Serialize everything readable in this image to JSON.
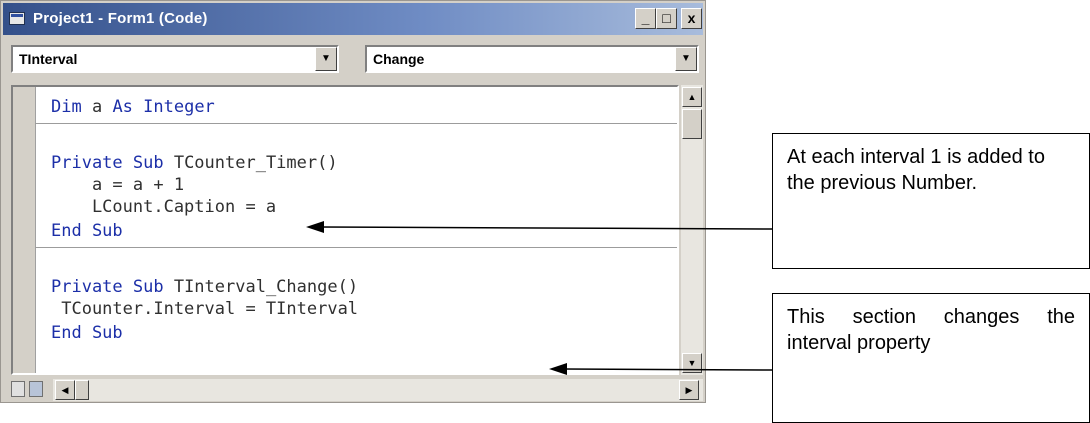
{
  "window": {
    "title": "Project1 - Form1 (Code)",
    "minimize_label": "_",
    "maximize_label": "□",
    "close_label": "x"
  },
  "object_combo": {
    "value": "TInterval"
  },
  "procedure_combo": {
    "value": "Change"
  },
  "code_lines": [
    "Dim a As Integer",
    "Private Sub TCounter_Timer()",
    "    a = a + 1",
    "    LCount.Caption = a",
    "End Sub",
    "Private Sub TInterval_Change()",
    " TCounter.Interval = TInterval",
    "End Sub"
  ],
  "annotations": {
    "note1": "At each interval 1 is added to the previous Number.",
    "note2": "This section changes the interval property"
  },
  "icons": [
    "app-icon",
    "dropdown-arrow-icon",
    "scroll-up-icon",
    "scroll-down-icon",
    "scroll-left-icon",
    "scroll-right-icon",
    "procedure-view-icon",
    "full-module-view-icon",
    "arrow-icon"
  ]
}
